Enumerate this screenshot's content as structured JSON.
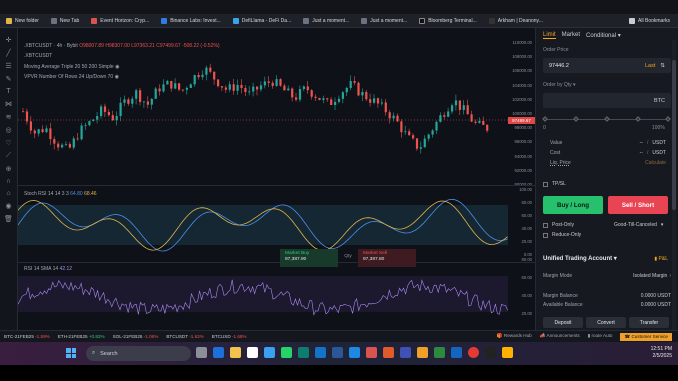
{
  "bookmarks": [
    {
      "label": "New folder"
    },
    {
      "label": "New Tab"
    },
    {
      "label": "Event Horizon: Cryp..."
    },
    {
      "label": "Binance Labs: Invest..."
    },
    {
      "label": "DefiLlama - DeFi Da..."
    },
    {
      "label": "Just a moment..."
    },
    {
      "label": "Just a moment..."
    },
    {
      "label": "Bloomberg Terminal..."
    },
    {
      "label": "Arkham | Deanony..."
    }
  ],
  "all_bookmarks": "All Bookmarks",
  "chart": {
    "symbol_line": ".XBTCUSDT · 4h · Bybit",
    "ohlc": "O98007.89 H98307.00 L97363.21 C97499.67 -508.22 (-0.52%)",
    "sub_symbol": ".XBTCUSDT",
    "indicator1": "Moving Average Triple 20 50 200 Simple",
    "indicator2": "VPVR Number Of Rows 24 Up/Down 70",
    "last_price": "97499.67",
    "price_axis": [
      "110000.00",
      "108000.00",
      "106000.00",
      "104000.00",
      "102000.00",
      "100000.00",
      "98000.00",
      "96000.00",
      "94000.00",
      "92000.00",
      "90000.00"
    ],
    "stoch_label": "Stoch RSI 14 14 3 3",
    "stoch_v1": "64.80",
    "stoch_v2": "68.46",
    "stoch_axis": [
      "100.00",
      "80.00",
      "60.00",
      "40.00",
      "20.00",
      "0.00"
    ],
    "rsi_label": "RSI 14 SMA 14",
    "rsi_v": "42.12",
    "rsi_axis": [
      "80.00",
      "60.00",
      "40.00",
      "20.00"
    ],
    "market_buy_label": "Market Buy",
    "market_buy_price": "97,387.90",
    "qty_label": "Qty",
    "market_sell_label": "Market Sell",
    "market_sell_price": "97,387.80"
  },
  "ticker": [
    {
      "name": "BTC-21FEB25",
      "change": "-1.59%",
      "dir": "down"
    },
    {
      "name": "ETH-21FEB25",
      "change": "+0.82%",
      "dir": "up"
    },
    {
      "name": "SOL-21FEB25",
      "change": "-1.06%",
      "dir": "down"
    },
    {
      "name": "BTCUSDT",
      "change": "-1.63%",
      "dir": "down"
    },
    {
      "name": "BTCUSD",
      "change": "-1.68%",
      "dir": "down"
    }
  ],
  "status": {
    "rewards": "Rewards Hub",
    "announcements": "Announcements",
    "route": "route Auto",
    "customer_service": "Customer Service"
  },
  "order_panel": {
    "tabs": [
      "Limit",
      "Market",
      "Conditional"
    ],
    "order_price_label": "Order Price",
    "order_price_value": "97446.2",
    "order_price_suffix": "Last",
    "qty_placeholder": "Order by Qty",
    "qty_unit": "BTC",
    "slider_min": "0",
    "slider_max": "100%",
    "value_label": "Value",
    "value_val": "--",
    "value_unit": "USDT",
    "cost_label": "Cost",
    "cost_val": "--",
    "cost_unit": "USDT",
    "liq_label": "Liq. Price",
    "liq_val": "Calculate",
    "tpsl": "TP/SL",
    "buy": "Buy / Long",
    "sell": "Sell / Short",
    "post_only": "Post-Only",
    "tif": "Good-Till-Canceled",
    "reduce_only": "Reduce-Only",
    "account_title": "Unified Trading Account",
    "pl": "P&L",
    "margin_mode_label": "Margin Mode",
    "margin_mode_value": "Isolated Margin",
    "margin_balance_label": "Margin Balance",
    "margin_balance_value": "0.0000 USDT",
    "available_balance_label": "Available Balance",
    "available_balance_value": "0.0000 USDT",
    "deposit": "Deposit",
    "convert": "Convert",
    "transfer": "Transfer"
  },
  "taskbar": {
    "search_placeholder": "Search",
    "time": "12:51 PM",
    "date": "2/5/2025"
  }
}
